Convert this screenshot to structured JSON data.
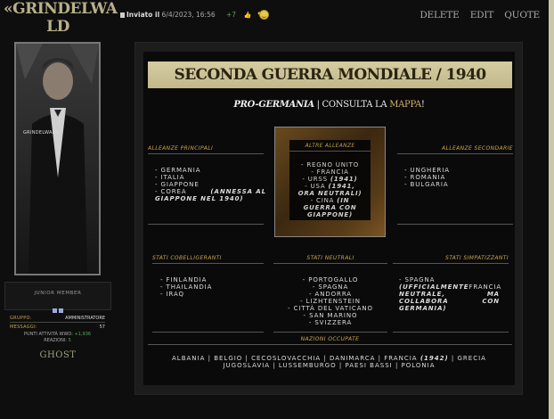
{
  "profile": {
    "username_line1": "«GRINDELWA",
    "username_line2": "LD",
    "avatar_caption": "GRINDELWALD",
    "rank": "JUNIOR MEMBER",
    "group_label": "GRUPPO:",
    "group_value": "AMMINISTRATORE",
    "messages_label": "MESSAGGI:",
    "messages_value": "57",
    "activity_label": "PUNTI ATTIVITÀ WWO:",
    "activity_value": "+1,936",
    "reactions_label": "REAZIONI:",
    "reactions_value": "5",
    "status": "GHOST"
  },
  "post": {
    "sent_label": "Inviato il",
    "date": "6/4/2023, 16:56",
    "score": "+7",
    "actions": {
      "delete": "DELETE",
      "edit": "EDIT",
      "quote": "QUOTE"
    }
  },
  "content": {
    "title": "SECONDA GUERRA MONDIALE / 1940",
    "subtitle_pro": "PRO-GERMANIA",
    "subtitle_sep": " | CONSULTA LA ",
    "subtitle_link": "MAPPA",
    "subtitle_end": "!",
    "alleanze_principali": {
      "heading": "ALLEANZE PRINCIPALI",
      "l1": "- GERMANIA",
      "l2": "- ITALIA",
      "l3": "- GIAPPONE",
      "l4a": "- COREA ",
      "l4b": "(ANNESSA AL",
      "l5": "GIAPPONE NEL 1940)"
    },
    "altre_alleanze": {
      "heading": "ALTRE ALLEANZE",
      "l1": "- REGNO UNITO",
      "l2": "- FRANCIA",
      "l3a": "- URSS ",
      "l3b": "(1941)",
      "l4a": "- USA ",
      "l4b": "(1941,",
      "l5": "ORA NEUTRALI)",
      "l6a": "- CINA ",
      "l6b": "(IN",
      "l7": "GUERRA CON",
      "l8": "GIAPPONE)"
    },
    "alleanze_secondarie": {
      "heading": "ALLEANZE SECONDARIE",
      "l1": "- UNGHERIA",
      "l2": "- ROMANIA",
      "l3": "- BULGARIA"
    },
    "stati_cobelligeranti": {
      "heading": "STATI COBELLIGERANTI",
      "l1": "- FINLANDIA",
      "l2": "- THAILANDIA",
      "l3": "- IRAQ"
    },
    "stati_neutrali": {
      "heading": "STATI NEUTRALI",
      "l1": "- PORTOGALLO",
      "l2": "- SPAGNA",
      "l3": "- ANDORRA",
      "l4": "- LIZHTENSTEIN",
      "l5": "- CITTÀ DEL VATICANO",
      "l6": "- SAN MARINO",
      "l7": "- SVIZZERA"
    },
    "stati_simpatizzanti": {
      "heading": "STATI SIMPATIZZANTI",
      "l1": "- SPAGNA",
      "l2a": "(UFFICIALMENTE",
      "l2b": "FRANCIA",
      "l3": "NEUTRALE,",
      "l3b": "MA",
      "l4": "COLLABORA",
      "l4b": "CON",
      "l5": "GERMANIA)"
    },
    "nazioni_occupate": {
      "heading": "NAZIONI OCCUPATE",
      "l1a": "ALBANIA | BELGIO | CECOSLOVACCHIA | DANIMARCA | FRANCIA ",
      "l1b": "(1942)",
      "l1c": " | GRECIA",
      "l2": "JUGOSLAVIA | LUSSEMBURGO | PAESI BASSI | POLONIA"
    }
  },
  "colors": {
    "accent_gold": "#c9a54e",
    "banner": "#d5cca3",
    "positive": "#5aa65a"
  }
}
